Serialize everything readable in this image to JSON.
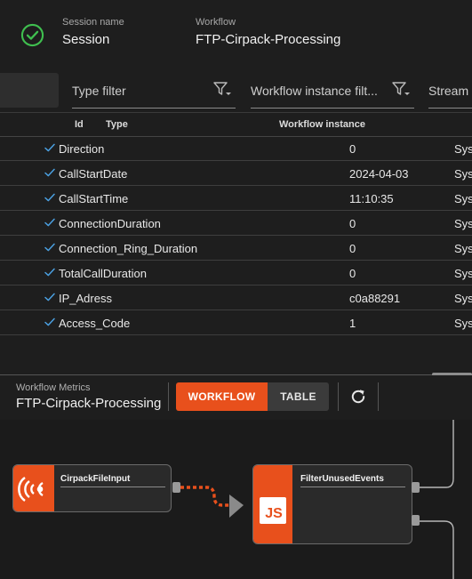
{
  "header": {
    "session_label": "Session name",
    "session_value": "Session",
    "workflow_label": "Workflow",
    "workflow_value": "FTP-Cirpack-Processing",
    "status_icon": "check-circle-icon",
    "status_color": "#3fbf4f"
  },
  "filters": {
    "type_placeholder": "Type filter",
    "instance_placeholder": "Workflow instance filt...",
    "stream_placeholder": "Stream"
  },
  "table": {
    "columns": [
      "Id",
      "Type",
      "Workflow instance"
    ],
    "rows": [
      {
        "name": "Direction",
        "instance": "0",
        "stream": "Sys"
      },
      {
        "name": "CallStartDate",
        "instance": "2024-04-03",
        "stream": "Sys"
      },
      {
        "name": "CallStartTime",
        "instance": "11:10:35",
        "stream": "Sys"
      },
      {
        "name": "ConnectionDuration",
        "instance": "0",
        "stream": "Sys"
      },
      {
        "name": "Connection_Ring_Duration",
        "instance": "0",
        "stream": "Sys"
      },
      {
        "name": "TotalCallDuration",
        "instance": "0",
        "stream": "Sys"
      },
      {
        "name": "IP_Adress",
        "instance": "c0a88291",
        "stream": "Sys"
      },
      {
        "name": "Access_Code",
        "instance": "1",
        "stream": "Sys"
      }
    ]
  },
  "metrics": {
    "label": "Workflow Metrics",
    "value": "FTP-Cirpack-Processing",
    "workflow_btn": "WORKFLOW",
    "table_btn": "TABLE",
    "refresh_icon": "refresh-icon"
  },
  "nodes": {
    "input": {
      "title": "CirpackFileInput",
      "icon": "broadcast-icon"
    },
    "filter": {
      "title": "FilterUnusedEvents",
      "icon": "js-icon",
      "icon_text": "JS"
    }
  },
  "colors": {
    "accent": "#e8501c",
    "check": "#4a9fe0"
  }
}
